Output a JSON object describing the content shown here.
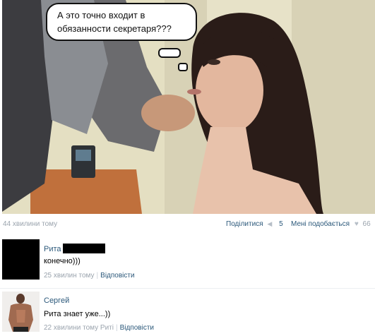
{
  "post": {
    "speech_bubble": "А это точно входит в обязанности секретаря???",
    "time": "44 хвилини тому",
    "share_label": "Поділитися",
    "share_count": "5",
    "like_label": "Мені подобається",
    "like_count": "66"
  },
  "comments": [
    {
      "author": "Рита",
      "text": "конечно)))",
      "time": "25 хвилин тому",
      "reply_label": "Відповісти"
    },
    {
      "author": "Сергей",
      "text": "Рита знает уже...))",
      "time": "22 хвилини тому Риті",
      "reply_label": "Відповісти"
    }
  ],
  "colors": {
    "link": "#2b587a",
    "muted": "#9aa3ad"
  }
}
